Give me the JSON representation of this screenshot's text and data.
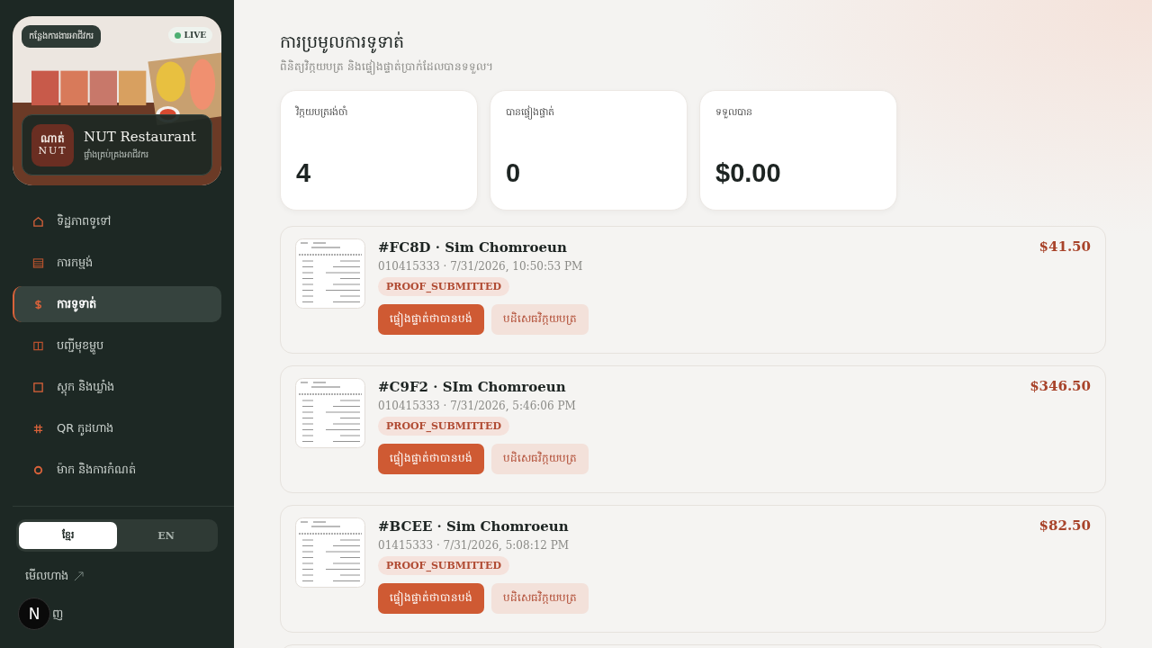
{
  "sidebar": {
    "banner": {
      "kind": "picture",
      "chip": "កន្លែងការងារអាជីវករ",
      "live": "LIVE"
    },
    "brand": {
      "logo_top": "ណាត់",
      "logo_bottom": "NUT",
      "name": "NUT Restaurant",
      "subtitle": "ផ្ទាំងគ្រប់គ្រងអាជីវករ"
    },
    "items": [
      {
        "kind": "home",
        "label": "ទិដ្ឋភាពទូទៅ",
        "selected": false
      },
      {
        "kind": "orders",
        "label": "ការកម្មង់",
        "selected": false
      },
      {
        "kind": "payments",
        "label": "ការទូទាត់",
        "selected": true
      },
      {
        "kind": "menu",
        "label": "បញ្ជីមុខម្ហូប",
        "selected": false
      },
      {
        "kind": "stock",
        "label": "ស្តុក និងឃ្លាំង",
        "selected": false
      },
      {
        "kind": "qr",
        "label": "QR កូដហាង",
        "selected": false
      },
      {
        "kind": "settings",
        "label": "ម៉ាក និងការកំណត់",
        "selected": false
      }
    ],
    "languages": [
      {
        "label": "ខ្មែរ",
        "selected": true
      },
      {
        "label": "EN",
        "selected": false
      }
    ],
    "view_store": "មើលហាង",
    "logout": "ញ",
    "dev_badge": "N"
  },
  "page": {
    "title": "ការប្រមូលការទូទាត់",
    "subtitle": "ពិនិត្យវិក្កយបត្រ និងផ្ទៀងផ្ទាត់ប្រាក់ដែលបានទទួល។"
  },
  "stats": [
    {
      "label": "វិក្កយបត្ររង់ចាំ",
      "value": "4"
    },
    {
      "label": "បានផ្ទៀងផ្ទាត់",
      "value": "0"
    },
    {
      "label": "ទទួលបាន",
      "value": "$0.00"
    }
  ],
  "payments": [
    {
      "title": "#FC8D · Sim Chomroeun",
      "meta": "010415333 · 7/31/2026, 10:50:53 PM",
      "status": "PROOF_SUBMITTED",
      "amount": "$41.50",
      "verify": "ផ្ទៀងផ្ទាត់ថាបានបង់",
      "reject": "បដិសេធវិក្កយបត្រ"
    },
    {
      "title": "#C9F2 · SIm Chomroeun",
      "meta": "010415333 · 7/31/2026, 5:46:06 PM",
      "status": "PROOF_SUBMITTED",
      "amount": "$346.50",
      "verify": "ផ្ទៀងផ្ទាត់ថាបានបង់",
      "reject": "បដិសេធវិក្កយបត្រ"
    },
    {
      "title": "#BCEE · Sim Chomroeun",
      "meta": "01415333 · 7/31/2026, 5:08:12 PM",
      "status": "PROOF_SUBMITTED",
      "amount": "$82.50",
      "verify": "ផ្ទៀងផ្ទាត់ថាបានបង់",
      "reject": "បដិសេធវិក្កយបត្រ"
    }
  ]
}
